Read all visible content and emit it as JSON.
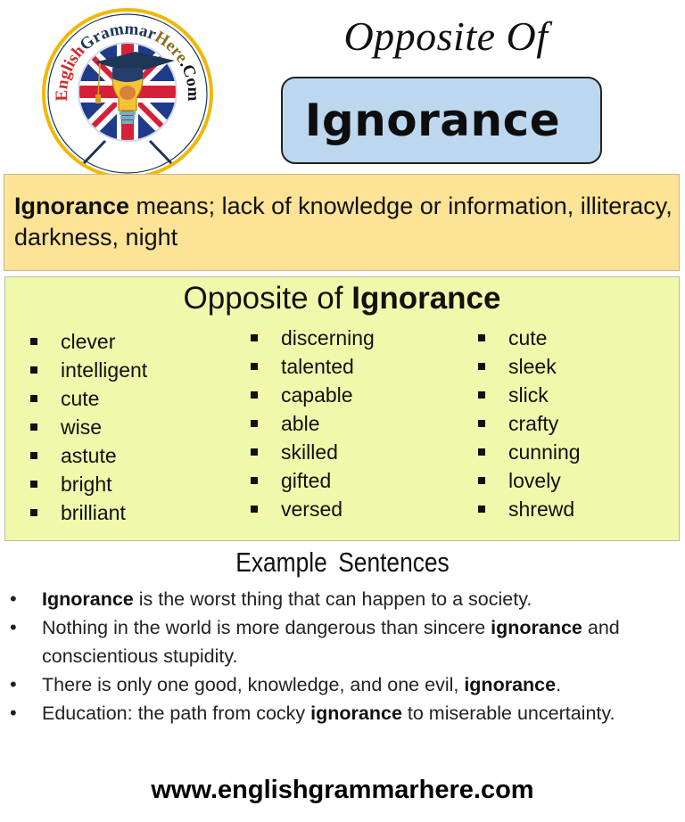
{
  "logo": {
    "text_english": "English",
    "text_grammar": "Grammar",
    "text_here": "Here",
    "text_com": ".Com",
    "colors": {
      "ring": "#f2b705",
      "english": "#d62828",
      "grammar": "#1d3557",
      "here": "#8a6d1e",
      "com": "#111111"
    }
  },
  "header": {
    "title": "Opposite Of",
    "word": "Ignorance"
  },
  "definition": {
    "word": "Ignorance",
    "text": " means; lack of knowledge or information, illiteracy, darkness, night"
  },
  "antonyms": {
    "title_prefix": "Opposite of ",
    "title_word": "Ignorance",
    "columns": [
      [
        "clever",
        "intelligent",
        "cute",
        "wise",
        "astute",
        "bright",
        "brilliant"
      ],
      [
        "discerning",
        "talented",
        "capable",
        "able",
        "skilled",
        "gifted",
        "versed"
      ],
      [
        "cute",
        "sleek",
        "slick",
        "crafty",
        "cunning",
        "lovely",
        "shrewd"
      ]
    ]
  },
  "examples": {
    "title": "Example Sentences",
    "sentences": [
      {
        "before": "",
        "bold": "Ignorance",
        "after": " is the worst thing that can happen to a society."
      },
      {
        "before": "Nothing in the world is more dangerous than sincere ",
        "bold": "ignorance",
        "after": " and conscientious stupidity."
      },
      {
        "before": "There is only one good, knowledge, and one evil, ",
        "bold": "ignorance",
        "after": "."
      },
      {
        "before": "Education: the path from cocky ",
        "bold": "ignorance",
        "after": " to miserable uncertainty."
      }
    ]
  },
  "footer": {
    "url": "www.englishgrammarhere.com"
  }
}
